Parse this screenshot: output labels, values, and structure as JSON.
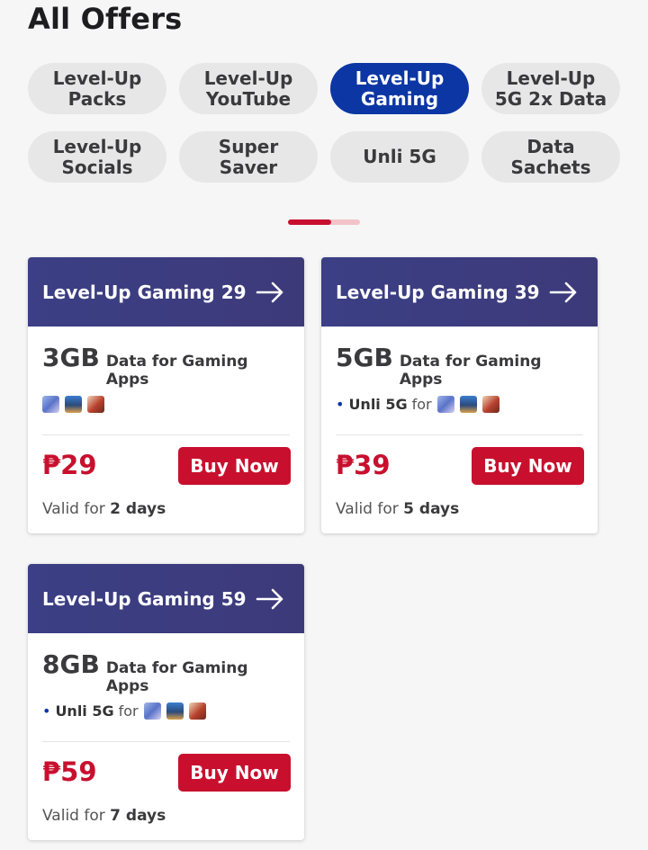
{
  "page_title": "All Offers",
  "categories": [
    {
      "label": "Level-Up\nPacks",
      "active": false
    },
    {
      "label": "Level-Up\nYouTube",
      "active": false
    },
    {
      "label": "Level-Up\nGaming",
      "active": true
    },
    {
      "label": "Level-Up\n5G 2x Data",
      "active": false
    },
    {
      "label": "Level-Up\nSocials",
      "active": false
    },
    {
      "label": "Super\nSaver",
      "active": false
    },
    {
      "label": "Unli 5G",
      "active": false
    },
    {
      "label": "Data\nSachets",
      "active": false
    }
  ],
  "pager": {
    "fraction": 0.6
  },
  "offers": [
    {
      "name": "Level-Up Gaming 29",
      "data_amount": "3GB",
      "data_desc": "Data for Gaming Apps",
      "unli_label": "",
      "for_label": "",
      "apps": [
        "game-app-icon",
        "game-app-icon",
        "game-app-icon"
      ],
      "price": "₱29",
      "buy_label": "Buy Now",
      "valid_prefix": "Valid for",
      "valid_days": "2 days"
    },
    {
      "name": "Level-Up Gaming 39",
      "data_amount": "5GB",
      "data_desc": "Data for Gaming Apps",
      "unli_label": "Unli 5G",
      "for_label": "for",
      "apps": [
        "game-app-icon",
        "game-app-icon",
        "game-app-icon"
      ],
      "price": "₱39",
      "buy_label": "Buy Now",
      "valid_prefix": "Valid for",
      "valid_days": "5 days"
    },
    {
      "name": "Level-Up Gaming 59",
      "data_amount": "8GB",
      "data_desc": "Data for Gaming Apps",
      "unli_label": "Unli 5G",
      "for_label": "for",
      "apps": [
        "game-app-icon",
        "game-app-icon",
        "game-app-icon"
      ],
      "price": "₱59",
      "buy_label": "Buy Now",
      "valid_prefix": "Valid for",
      "valid_days": "7 days"
    }
  ],
  "colors": {
    "brand_red": "#c8102e",
    "active_chip": "#0c36a3",
    "card_header": "#3c3f85"
  }
}
